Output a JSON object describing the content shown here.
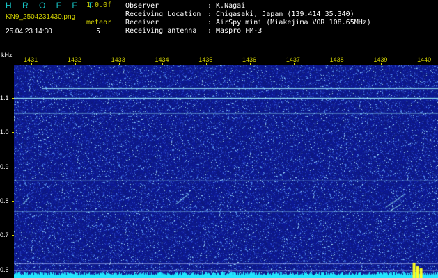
{
  "header": {
    "brand": "H R O F F T",
    "version": "1.0.0f",
    "filename": "KN9_2504231430.png",
    "mode": "meteor",
    "datetime": "25.04.23 14:30",
    "count": "5"
  },
  "station": [
    {
      "label": "Observer",
      "value": ": K.Nagai"
    },
    {
      "label": "Receiving Location",
      "value": ": Chigasaki, Japan (139.414 35.340)"
    },
    {
      "label": "Receiver",
      "value": ": AirSpy mini (Miakejima VOR 108.65MHz)"
    },
    {
      "label": "Receiving antenna",
      "value": ": Maspro FM-3"
    }
  ],
  "spectrogram": {
    "y_unit": "kHz",
    "x_ticks": [
      "1431",
      "1432",
      "1433",
      "1434",
      "1435",
      "1436",
      "1437",
      "1438",
      "1439",
      "1440"
    ],
    "y_ticks": [
      "1.1",
      "1.0",
      "0.9",
      "0.8",
      "0.7",
      "0.6"
    ],
    "x_range": [
      1430.6,
      1440.3
    ],
    "y_range": [
      0.575,
      1.195
    ],
    "background_color": "#101c8a",
    "trace_color": "#9ff3ff",
    "spectrum_color": "#22e6ff",
    "peak_color": "#ffff22"
  }
}
